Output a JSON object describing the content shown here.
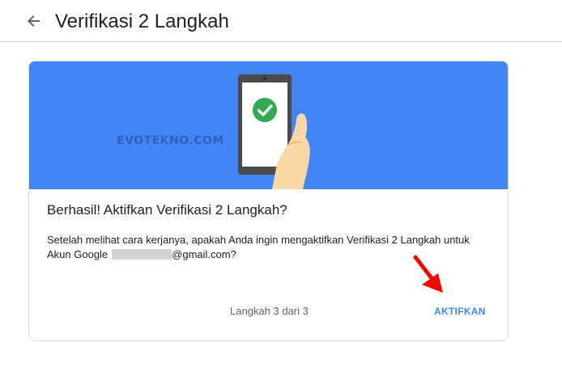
{
  "header": {
    "title": "Verifikasi 2 Langkah",
    "back_icon": "arrow-back-icon"
  },
  "hero": {
    "watermark": "EVOTEKNO.COM",
    "illustration": "phone-checkmark-hand",
    "colors": {
      "background": "#4285f4",
      "check": "#34a853",
      "hand": "#fdd8a7"
    }
  },
  "card": {
    "title": "Berhasil! Aktifkan Verifikasi 2 Langkah?",
    "body_line1": "Setelah melihat cara kerjanya, apakah Anda ingin mengaktifkan Verifikasi 2 Langkah untuk",
    "body_prefix": "Akun Google",
    "body_suffix": "@gmail.com?",
    "step": "Langkah 3 dari 3",
    "action_label": "AKTIFKAN"
  },
  "annotation": {
    "arrow_color": "#ff0000"
  }
}
